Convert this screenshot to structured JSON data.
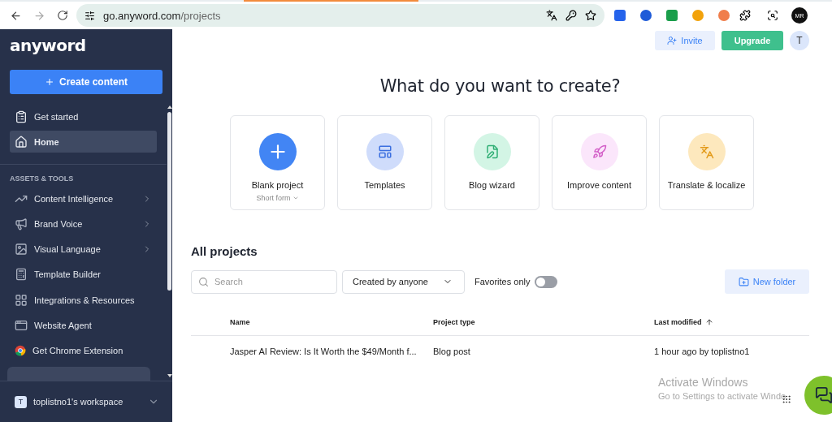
{
  "browser": {
    "url_host": "go.anyword.com",
    "url_path": "/projects",
    "profile": "MR"
  },
  "sidebar": {
    "logo": "anyword",
    "create_button": "Create content",
    "top_items": [
      {
        "label": "Get started",
        "selected": false
      },
      {
        "label": "Home",
        "selected": true
      }
    ],
    "section_title": "ASSETS & TOOLS",
    "items": [
      {
        "label": "Content Intelligence",
        "expandable": true
      },
      {
        "label": "Brand Voice",
        "expandable": true
      },
      {
        "label": "Visual Language",
        "expandable": true
      },
      {
        "label": "Template Builder",
        "expandable": false
      },
      {
        "label": "Integrations & Resources",
        "expandable": false
      },
      {
        "label": "Website Agent",
        "expandable": false
      },
      {
        "label": "Get Chrome Extension",
        "expandable": false
      }
    ],
    "workspace": {
      "initial": "T",
      "name": "toplistno1's workspace"
    }
  },
  "header": {
    "invite": "Invite",
    "upgrade": "Upgrade",
    "avatar": "T"
  },
  "heading": "What do you want to create?",
  "create_options": [
    {
      "label": "Blank project",
      "sublabel": "Short form",
      "color": "#4285f4"
    },
    {
      "label": "Templates",
      "color": "#cfdcfb"
    },
    {
      "label": "Blog wizard",
      "color": "#d3f5e5"
    },
    {
      "label": "Improve content",
      "color": "#fbe6fb"
    },
    {
      "label": "Translate & localize",
      "color": "#fde8bd"
    }
  ],
  "projects": {
    "title": "All projects",
    "search": {
      "placeholder": "Search"
    },
    "creator_filter": "Created by anyone",
    "favorites_label": "Favorites only",
    "favorites_only": false,
    "new_folder": "New folder",
    "columns": [
      "Name",
      "Project type",
      "Last modified"
    ],
    "rows": [
      {
        "name": "Jasper AI Review: Is It Worth the $49/Month f...",
        "type": "Blog post",
        "modified": "1 hour ago by toplistno1"
      }
    ]
  },
  "os_notice": {
    "title": "Activate Windows",
    "text": "Go to Settings to activate Windo"
  }
}
